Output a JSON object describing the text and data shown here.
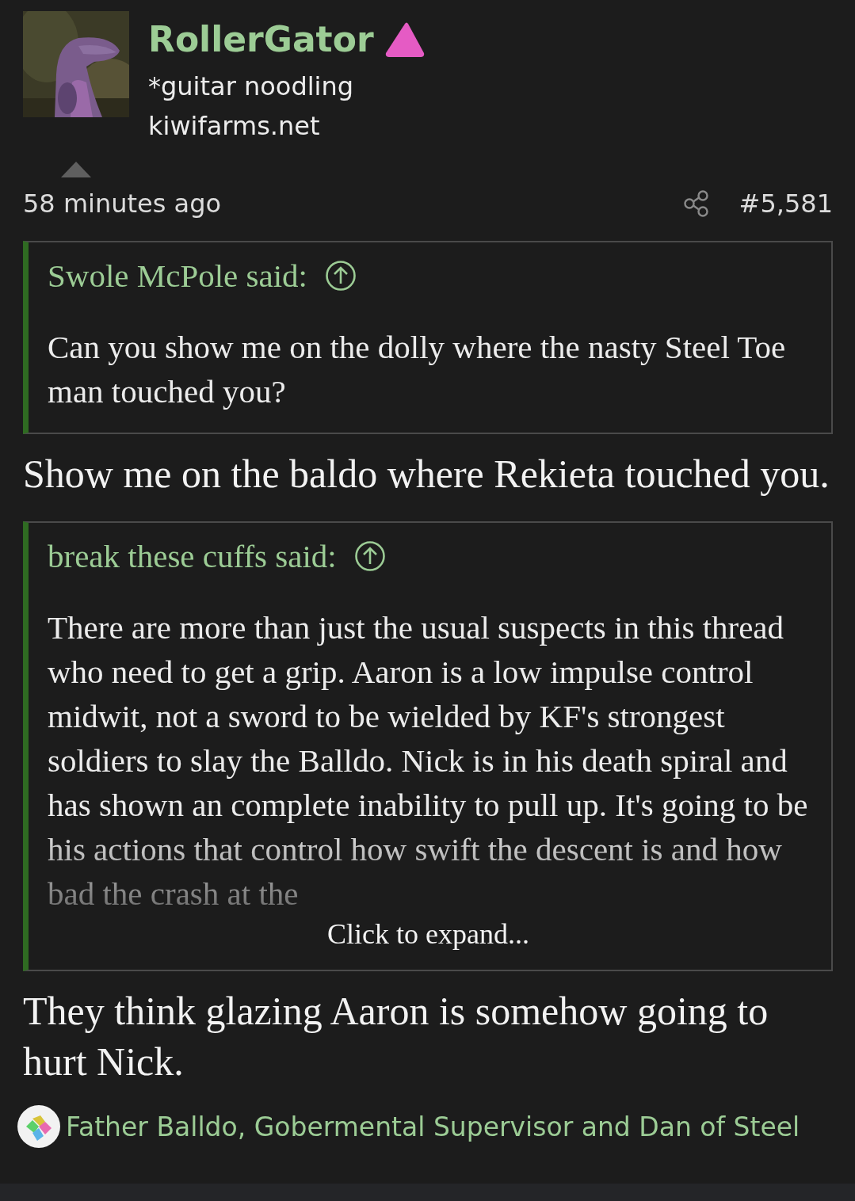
{
  "author": {
    "name": "RollerGator",
    "title": "*guitar noodling",
    "site": "kiwifarms.net"
  },
  "meta": {
    "time": "58 minutes ago",
    "number": "#5,581"
  },
  "blocks": [
    {
      "kind": "quote",
      "author": "Swole McPole said:",
      "text": "Can you show me on the dolly where the nasty Steel Toe man touched you?",
      "collapsed": false
    },
    {
      "kind": "text",
      "text": "Show me on the baldo where Rekieta touched you."
    },
    {
      "kind": "quote",
      "author": "break these cuffs said:",
      "text": "There are more than just the usual suspects in this thread who need to get a grip. Aaron is a low impulse control midwit, not a sword to be wielded by KF's strongest soldiers to slay the Balldo. Nick is in his death spiral and has shown an complete inability to pull up. It's going to be his actions that control how swift the descent is and how bad the crash at the",
      "collapsed": true,
      "expand_label": "Click to expand..."
    },
    {
      "kind": "text",
      "text": "They think glazing Aaron is somehow going to hurt Nick."
    }
  ],
  "reactions": {
    "text": "Father Balldo, Gobermental Supervisor and Dan of Steel"
  }
}
